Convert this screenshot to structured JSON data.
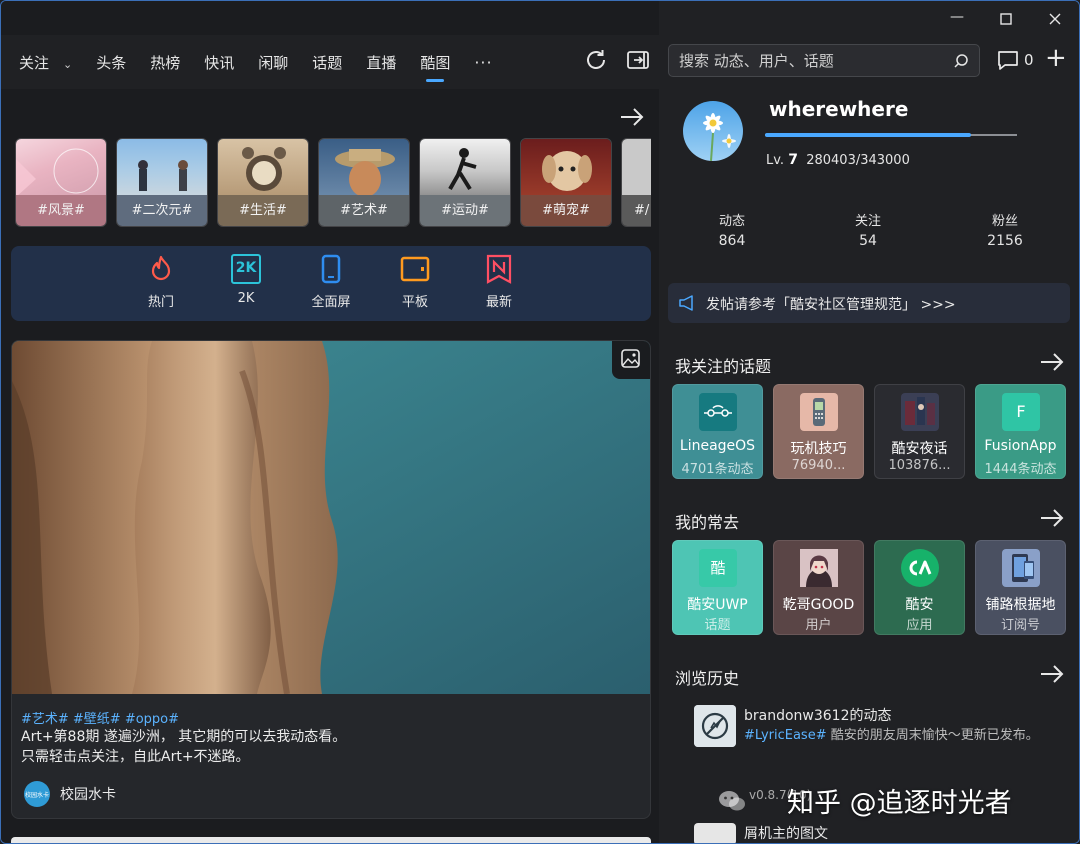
{
  "nav": {
    "tabs": [
      "关注",
      "头条",
      "热榜",
      "快讯",
      "闲聊",
      "话题",
      "直播",
      "酷图"
    ],
    "active": "酷图",
    "more": "···"
  },
  "categories": [
    {
      "label": "#风景#",
      "bg": "#b07783"
    },
    {
      "label": "#二次元#",
      "bg": "#5f6c7e"
    },
    {
      "label": "#生活#",
      "bg": "#7a6a56"
    },
    {
      "label": "#艺术#",
      "bg": "#5e6468"
    },
    {
      "label": "#运动#",
      "bg": "#6c7378"
    },
    {
      "label": "#萌宠#",
      "bg": "#7a4a3d"
    },
    {
      "label": "#/",
      "bg": "#5a5a5a"
    }
  ],
  "quick_links": [
    {
      "label": "热门",
      "icon": "fire-icon",
      "color": "#ff5a4a"
    },
    {
      "label": "2K",
      "icon": "2k-icon",
      "color": "#2cc3d9",
      "icon_text": "2K"
    },
    {
      "label": "全面屏",
      "icon": "phone-icon",
      "color": "#2f8df0"
    },
    {
      "label": "平板",
      "icon": "tablet-icon",
      "color": "#ff9a1f"
    },
    {
      "label": "最新",
      "icon": "new-icon",
      "color": "#ff4f63",
      "icon_text": "N"
    }
  ],
  "post": {
    "tags": "#艺术# #壁纸# #oppo#",
    "line1": "Art+第88期 遂遍沙洲， 其它期的可以去我动态看。",
    "line2": "只需轻击点关注，自此Art+不迷路。",
    "author": "校园水卡",
    "author_avatar_text": "校园水卡"
  },
  "search": {
    "placeholder": "搜索 动态、用户、话题"
  },
  "messages": {
    "count": "0"
  },
  "profile": {
    "username": "wherewhere",
    "level_label": "Lv.",
    "level": "7",
    "exp": "280403/343000",
    "exp_progress": 0.817,
    "stats": [
      {
        "label": "动态",
        "value": "864"
      },
      {
        "label": "关注",
        "value": "54"
      },
      {
        "label": "粉丝",
        "value": "2156"
      }
    ]
  },
  "notice": "发帖请参考「酷安社区管理规范」 >>>",
  "topics": {
    "title": "我关注的话题",
    "items": [
      {
        "name": "LineageOS",
        "sub": "4701条动态",
        "bg": "#3f8f95",
        "icon_bg": "#167a80"
      },
      {
        "name": "玩机技巧",
        "sub": "76940...",
        "bg": "#8a6a62",
        "icon_bg": "#e6b8a8"
      },
      {
        "name": "酷安夜话",
        "sub": "103876...",
        "bg": "#2a2b30",
        "icon_bg": "#3b3f55"
      },
      {
        "name": "FusionApp",
        "sub": "1444条动态",
        "bg": "#3a9b86",
        "icon_bg": "#2fc5a5",
        "icon_text": "F"
      }
    ]
  },
  "frequent": {
    "title": "我的常去",
    "items": [
      {
        "name": "酷安UWP",
        "sub": "话题",
        "bg": "#4ec5b4",
        "icon_bg": "#37c9a8",
        "icon_text": "酷"
      },
      {
        "name": "乾哥GOOD",
        "sub": "用户",
        "bg": "#5a4546",
        "icon_bg": "#c9a4a0"
      },
      {
        "name": "酷安",
        "sub": "应用",
        "bg": "#2d6b50",
        "icon_bg": "#17b26a"
      },
      {
        "name": "铺路根据地",
        "sub": "订阅号",
        "bg": "#4a5061",
        "icon_bg": "#8aa0c8"
      }
    ]
  },
  "history": {
    "title": "浏览历史",
    "items": [
      {
        "title": "brandonw3612的动态",
        "tag": "#LyricEase#",
        "body": " 酷安的朋友周末愉快～更新已发布。",
        "meta": "v0.8.7(10)"
      },
      {
        "title": "屑机主的图文",
        "tag": "",
        "body": "",
        "meta": ""
      }
    ]
  },
  "watermark": "知乎 @追逐时光者",
  "colors": {
    "accent": "#4aa8ff",
    "tag": "#5bb3ff"
  }
}
